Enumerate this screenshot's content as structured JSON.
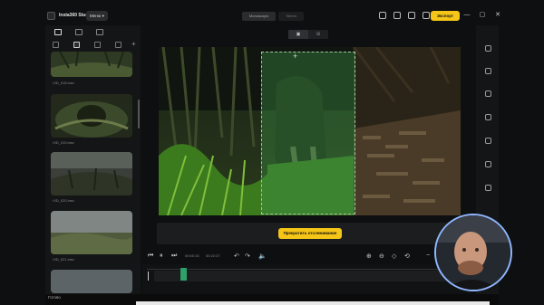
{
  "titlebar": {
    "app_title": "Insta360 Studio",
    "menu_label": "Меню",
    "mode_tabs": [
      "Monoscopic",
      "Stereo"
    ],
    "export_label": "Экспорт",
    "window_controls": [
      "—",
      "▢",
      "✕"
    ]
  },
  "left_panel": {
    "add_label": "+",
    "thumbnails": [
      {
        "label": "VID_018.insv"
      },
      {
        "label": "VID_019.insv"
      },
      {
        "label": "VID_020.insv"
      },
      {
        "label": "VID_021.insv"
      },
      {
        "label": ""
      }
    ]
  },
  "preview": {
    "view_toggle": [
      "▣",
      "⊞"
    ],
    "track_button_label": "Прекратить отслеживание",
    "crosshair": "+"
  },
  "playback": {
    "current_time": "00:00:15",
    "total_time": "00:22:37"
  },
  "status": {
    "text": "Готово"
  },
  "colors": {
    "accent": "#f5c518",
    "selection": "#3c9646",
    "playhead": "#2fa06a"
  }
}
